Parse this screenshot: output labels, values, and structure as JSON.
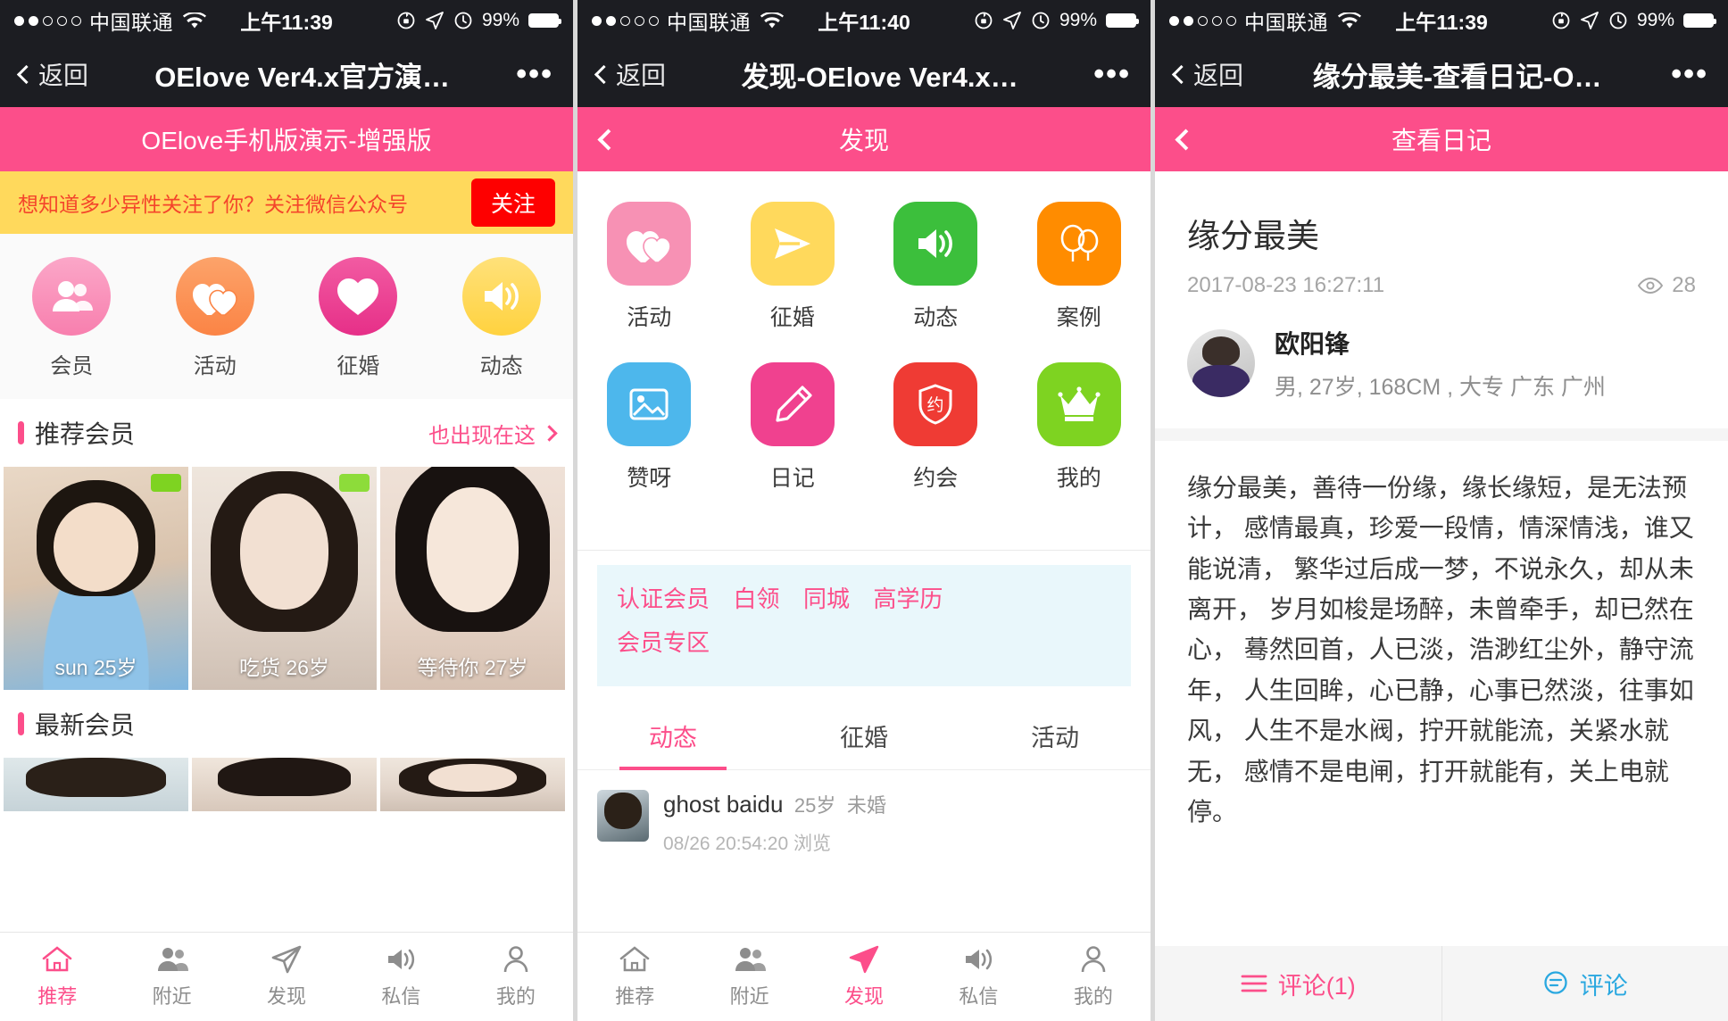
{
  "panels": [
    {
      "statusbar": {
        "carrier": "中国联通",
        "time": "上午11:39",
        "battery": "99%"
      },
      "navbar": {
        "back": "返回",
        "title": "OElove Ver4.x官方演…",
        "more": "•••"
      },
      "apphead": {
        "title": "OElove手机版演示-增强版"
      },
      "promo": {
        "text": "想知道多少异性关注了你？关注微信公众号",
        "button": "关注"
      },
      "grid": [
        {
          "label": "会员",
          "icon": "members-icon",
          "color": "#fb8ab5"
        },
        {
          "label": "活动",
          "icon": "double-heart-icon",
          "color": "#fb9255"
        },
        {
          "label": "征婚",
          "icon": "heart-icon",
          "color": "#ee3e91"
        },
        {
          "label": "动态",
          "icon": "speaker-icon",
          "color": "#ffd95c"
        }
      ],
      "sections": [
        {
          "title": "推荐会员",
          "more": "也出现在这"
        },
        {
          "title": "最新会员",
          "more": ""
        }
      ],
      "cards": [
        {
          "name": "sun",
          "age": "25岁",
          "badge": true
        },
        {
          "name": "吃货",
          "age": "26岁",
          "badge": true
        },
        {
          "name": "等待你",
          "age": "27岁",
          "badge": false
        }
      ],
      "tabbar": [
        {
          "label": "推荐",
          "icon": "home-icon",
          "active": true
        },
        {
          "label": "附近",
          "icon": "people-icon",
          "active": false
        },
        {
          "label": "发现",
          "icon": "paperplane-icon",
          "active": false
        },
        {
          "label": "私信",
          "icon": "speaker-icon",
          "active": false
        },
        {
          "label": "我的",
          "icon": "person-icon",
          "active": false
        }
      ]
    },
    {
      "statusbar": {
        "carrier": "中国联通",
        "time": "上午11:40",
        "battery": "99%"
      },
      "navbar": {
        "back": "返回",
        "title": "发现-OElove Ver4.x…",
        "more": "•••"
      },
      "apphead": {
        "title": "发现"
      },
      "grid": [
        {
          "label": "活动",
          "icon": "double-heart-icon",
          "color": "#f791b4"
        },
        {
          "label": "征婚",
          "icon": "paperplane-icon",
          "color": "#ffd95c"
        },
        {
          "label": "动态",
          "icon": "speaker-icon",
          "color": "#3cbf3c"
        },
        {
          "label": "案例",
          "icon": "balloons-icon",
          "color": "#ff8c00"
        },
        {
          "label": "赞呀",
          "icon": "photo-icon",
          "color": "#4db7ec"
        },
        {
          "label": "日记",
          "icon": "pencil-icon",
          "color": "#f0418f"
        },
        {
          "label": "约会",
          "icon": "shield-date-icon",
          "color": "#ef3b34"
        },
        {
          "label": "我的",
          "icon": "crown-icon",
          "color": "#7ed321"
        }
      ],
      "tags": [
        "认证会员",
        "白领",
        "同城",
        "高学历",
        "会员专区"
      ],
      "tabs": [
        {
          "label": "动态",
          "active": true
        },
        {
          "label": "征婚",
          "active": false
        },
        {
          "label": "活动",
          "active": false
        }
      ],
      "feed": {
        "name": "ghost baidu",
        "age": "25岁",
        "status": "未婚",
        "sub": "08/26 20:54:20 浏览"
      },
      "tabbar": [
        {
          "label": "推荐",
          "icon": "home-icon",
          "active": false
        },
        {
          "label": "附近",
          "icon": "people-icon",
          "active": false
        },
        {
          "label": "发现",
          "icon": "paperplane-icon",
          "active": true
        },
        {
          "label": "私信",
          "icon": "speaker-icon",
          "active": false
        },
        {
          "label": "我的",
          "icon": "person-icon",
          "active": false
        }
      ]
    },
    {
      "statusbar": {
        "carrier": "中国联通",
        "time": "上午11:39",
        "battery": "99%"
      },
      "navbar": {
        "back": "返回",
        "title": "缘分最美-查看日记-O…",
        "more": "•••"
      },
      "apphead": {
        "title": "查看日记"
      },
      "diary": {
        "title": "缘分最美",
        "date": "2017-08-23 16:27:11",
        "views": "28",
        "author": "欧阳锋",
        "author_info": "男, 27岁, 168CM , 大专 广东 广州",
        "body": "缘分最美，善待一份缘，缘长缘短，是无法预计，\n感情最真，珍爱一段情，情深情浅，谁又能说清，\n繁华过后成一梦，不说永久，却从未离开，\n岁月如梭是场醉，未曾牵手，却已然在心，\n蓦然回首，人已淡，浩渺红尘外，静守流年，\n人生回眸，心已静，心事已然淡，往事如风，\n人生不是水阀，拧开就能流，关紧水就无，\n感情不是电闸，打开就能有，关上电就停。"
      },
      "commentbar": {
        "left": "评论(1)",
        "right": "评论"
      }
    }
  ]
}
